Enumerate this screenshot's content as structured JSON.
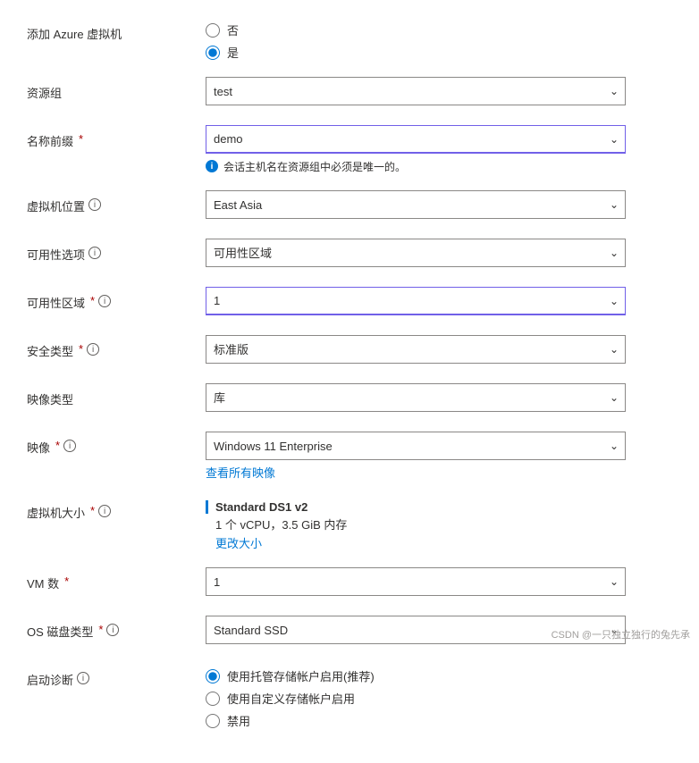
{
  "form": {
    "add_azure_vm": {
      "label": "添加 Azure 虚拟机",
      "options": [
        {
          "value": "no",
          "label": "否",
          "checked": false
        },
        {
          "value": "yes",
          "label": "是",
          "checked": true
        }
      ]
    },
    "resource_group": {
      "label": "资源组",
      "value": "test",
      "options": [
        "test"
      ]
    },
    "name_prefix": {
      "label": "名称前缀",
      "required": true,
      "value": "demo",
      "note": "会话主机名在资源组中必须是唯一的。"
    },
    "vm_location": {
      "label": "虚拟机位置",
      "has_info": true,
      "value": "East Asia"
    },
    "availability_option": {
      "label": "可用性选项",
      "has_info": true,
      "value": "可用性区域"
    },
    "availability_zone": {
      "label": "可用性区域",
      "required": true,
      "has_info": true,
      "value": "1",
      "active_border": true
    },
    "security_type": {
      "label": "安全类型",
      "required": true,
      "has_info": true,
      "value": "标准版"
    },
    "image_type": {
      "label": "映像类型",
      "value": "库"
    },
    "image": {
      "label": "映像",
      "required": true,
      "has_info": true,
      "value": "Windows 11 Enterprise",
      "link_label": "查看所有映像"
    },
    "vm_size": {
      "label": "虚拟机大小",
      "required": true,
      "has_info": true,
      "size_name": "Standard DS1 v2",
      "size_detail": "1 个 vCPU，3.5 GiB 内存",
      "change_link": "更改大小"
    },
    "vm_count": {
      "label": "VM 数",
      "required": true,
      "value": "1"
    },
    "os_disk_type": {
      "label": "OS 磁盘类型",
      "required": true,
      "has_info": true,
      "value": "Standard SSD"
    },
    "boot_diagnostics": {
      "label": "启动诊断",
      "has_info": true,
      "options": [
        {
          "value": "managed",
          "label": "使用托管存储帐户启用(推荐)",
          "checked": true
        },
        {
          "value": "custom",
          "label": "使用自定义存储帐户启用",
          "checked": false
        },
        {
          "value": "disabled",
          "label": "禁用",
          "checked": false
        }
      ]
    }
  },
  "watermark": "CSDN @一只独立独行的兔先承"
}
